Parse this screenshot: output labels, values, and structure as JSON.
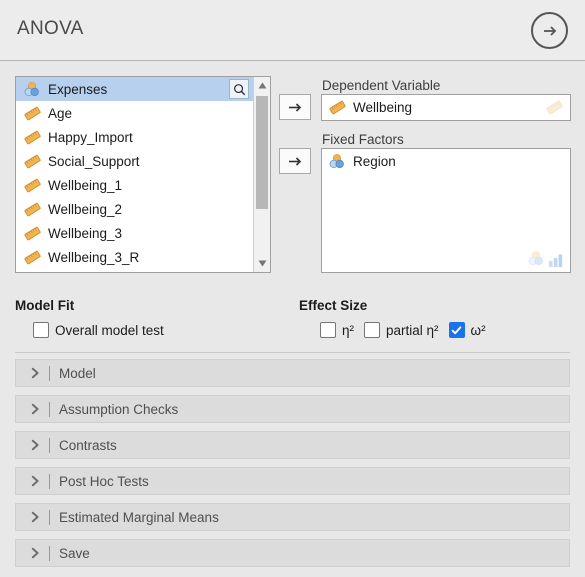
{
  "header": {
    "title": "ANOVA",
    "run_button": "arrow-right-circle"
  },
  "supplier": {
    "search_icon": "search-icon",
    "variables": [
      {
        "name": "Expenses",
        "type": "nominal",
        "selected": true
      },
      {
        "name": "Age",
        "type": "continuous",
        "selected": false
      },
      {
        "name": "Happy_Import",
        "type": "continuous",
        "selected": false
      },
      {
        "name": "Social_Support",
        "type": "continuous",
        "selected": false
      },
      {
        "name": "Wellbeing_1",
        "type": "continuous",
        "selected": false
      },
      {
        "name": "Wellbeing_2",
        "type": "continuous",
        "selected": false
      },
      {
        "name": "Wellbeing_3",
        "type": "continuous",
        "selected": false
      },
      {
        "name": "Wellbeing_3_R",
        "type": "continuous",
        "selected": false
      }
    ],
    "scroll": {
      "up_arrow": "triangle-up-icon",
      "down_arrow": "triangle-down-icon"
    }
  },
  "targets": [
    {
      "key": "dependent_variable",
      "label": "Dependent Variable",
      "items": [
        {
          "name": "Wellbeing",
          "type": "continuous"
        }
      ],
      "allowed_types": [
        "continuous"
      ]
    },
    {
      "key": "fixed_factors",
      "label": "Fixed Factors",
      "items": [
        {
          "name": "Region",
          "type": "nominal"
        }
      ],
      "allowed_types": [
        "nominal",
        "ordinal"
      ]
    }
  ],
  "model_fit": {
    "title": "Model Fit",
    "options": [
      {
        "label": "Overall model test",
        "checked": false
      }
    ]
  },
  "effect_size": {
    "title": "Effect Size",
    "options": [
      {
        "label": "η²",
        "checked": false
      },
      {
        "label": "partial η²",
        "checked": false
      },
      {
        "label": "ω²",
        "checked": true
      }
    ]
  },
  "sections": [
    {
      "label": "Model",
      "expanded": false
    },
    {
      "label": "Assumption Checks",
      "expanded": false
    },
    {
      "label": "Contrasts",
      "expanded": false
    },
    {
      "label": "Post Hoc Tests",
      "expanded": false
    },
    {
      "label": "Estimated Marginal Means",
      "expanded": false
    },
    {
      "label": "Save",
      "expanded": false
    }
  ],
  "colors": {
    "background": "#e8e8e8",
    "panel": "#ececec",
    "selection": "#b6d0ee",
    "accent_checked": "#1a73e8",
    "continuous_icon": "#e8a33d",
    "nominal_icon_a": "#f0b54a",
    "nominal_icon_b": "#6aa0dd",
    "section_bar": "#dcdcdc"
  }
}
